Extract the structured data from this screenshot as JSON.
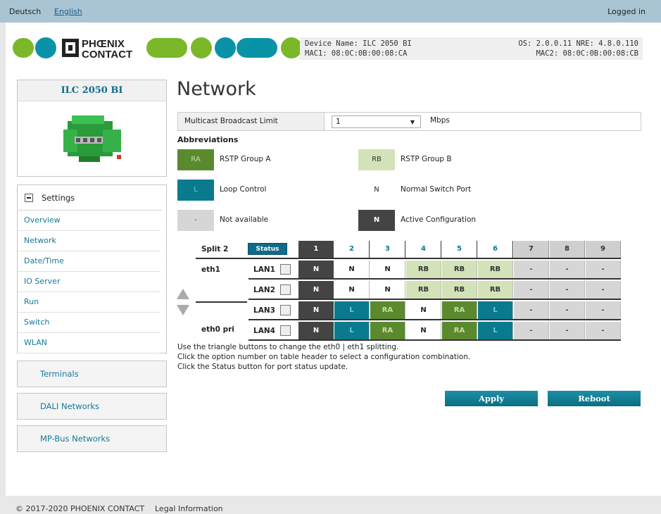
{
  "topbar": {
    "lang_de": "Deutsch",
    "lang_en": "English",
    "logged_in": "Logged in"
  },
  "header": {
    "device_name": "Device Name: ILC 2050 BI",
    "mac1": "MAC1: 08:0C:0B:00:08:CA",
    "os": "OS: 2.0.0.11 NRE: 4.8.0.110",
    "mac2": "MAC2: 08:0C:0B:00:08:CB",
    "logo_line1": "PHŒNIX",
    "logo_line2": "CONTACT"
  },
  "colors": {
    "accent": "#0e6b8a",
    "ra": "#5b8a2e",
    "rb": "#d3e2b8",
    "loop": "#0a7a8f",
    "na": "#d6d6d6",
    "active": "#444444"
  },
  "device_card": {
    "name": "ILC 2050 BI"
  },
  "sidebar": {
    "settings_label": "Settings",
    "items": [
      "Overview",
      "Network",
      "Date/Time",
      "IO Server",
      "Run",
      "Switch",
      "WLAN"
    ],
    "terminals": "Terminals",
    "dali": "DALI Networks",
    "mpbus": "MP-Bus Networks"
  },
  "main": {
    "title": "Network",
    "multicast_label": "Multicast Broadcast Limit",
    "multicast_value": "1",
    "multicast_unit": "Mbps",
    "abbr_title": "Abbreviations",
    "abbr": {
      "ra_code": "RA",
      "ra_label": "RSTP Group A",
      "rb_code": "RB",
      "rb_label": "RSTP Group B",
      "l_code": "L",
      "l_label": "Loop Control",
      "n_code": "N",
      "n_label": "Normal Switch Port",
      "na_code": "-",
      "na_label": "Not available",
      "act_code": "N",
      "act_label": "Active Configuration"
    },
    "split_label": "Split 2",
    "status_button": "Status",
    "option_numbers": [
      "1",
      "2",
      "3",
      "4",
      "5",
      "6",
      "7",
      "8",
      "9"
    ],
    "eth1": "eth1",
    "eth0": "eth0 pri",
    "rows": [
      {
        "lan": "LAN1",
        "cells": [
          "N",
          "N",
          "N",
          "RB",
          "RB",
          "RB",
          "-",
          "-",
          "-"
        ]
      },
      {
        "lan": "LAN2",
        "cells": [
          "N",
          "N",
          "N",
          "RB",
          "RB",
          "RB",
          "-",
          "-",
          "-"
        ]
      },
      {
        "lan": "LAN3",
        "cells": [
          "N",
          "L",
          "RA",
          "N",
          "RA",
          "L",
          "-",
          "-",
          "-"
        ]
      },
      {
        "lan": "LAN4",
        "cells": [
          "N",
          "L",
          "RA",
          "N",
          "RA",
          "L",
          "-",
          "-",
          "-"
        ]
      }
    ],
    "note1": "Use the triangle buttons to change the eth0 | eth1 splitting.",
    "note2": "Click the option number on table header to select a configuration combination.",
    "note3": "Click the Status button for port status update.",
    "apply": "Apply",
    "reboot": "Reboot"
  },
  "footer": {
    "copyright": "© 2017-2020 PHOENIX CONTACT",
    "legal": "Legal Information"
  }
}
